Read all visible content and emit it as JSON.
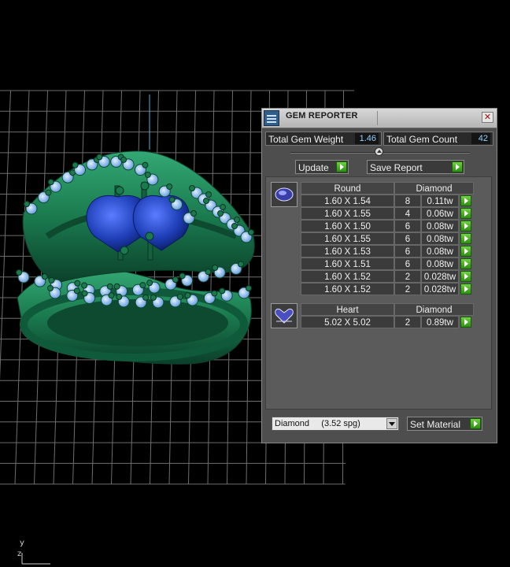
{
  "panel": {
    "title": "GEM REPORTER",
    "close_symbol": "✕",
    "total_gem_weight_label": "Total Gem Weight",
    "total_gem_weight_value": "1.46",
    "total_gem_count_label": "Total Gem Count",
    "total_gem_count_value": "42",
    "update_label": "Update",
    "save_report_label": "Save Report"
  },
  "gem_groups": [
    {
      "shape": "Round",
      "material": "Diamond",
      "icon": "round-gem-icon",
      "rows": [
        {
          "size": "1.60 X 1.54",
          "count": "8",
          "weight": "0.11tw"
        },
        {
          "size": "1.60 X 1.55",
          "count": "4",
          "weight": "0.06tw"
        },
        {
          "size": "1.60 X 1.50",
          "count": "6",
          "weight": "0.08tw"
        },
        {
          "size": "1.60 X 1.55",
          "count": "6",
          "weight": "0.08tw"
        },
        {
          "size": "1.60 X 1.53",
          "count": "6",
          "weight": "0.08tw"
        },
        {
          "size": "1.60 X 1.51",
          "count": "6",
          "weight": "0.08tw"
        },
        {
          "size": "1.60 X 1.52",
          "count": "2",
          "weight": "0.028tw"
        },
        {
          "size": "1.60 X 1.52",
          "count": "2",
          "weight": "0.028tw"
        }
      ]
    },
    {
      "shape": "Heart",
      "material": "Diamond",
      "icon": "heart-gem-icon",
      "rows": [
        {
          "size": "5.02 X 5.02",
          "count": "2",
          "weight": "0.89tw"
        }
      ]
    }
  ],
  "material": {
    "selected": "Diamond     (3.52 spg)",
    "set_material_label": "Set Material"
  },
  "viewport": {
    "axis_y": "y",
    "axis_z": "z",
    "colors": {
      "ring": "#1f8a5a",
      "ring_dark": "#0d4a30",
      "stone_accent": "#9ac8ff",
      "heart_stone": "#1f3fb8",
      "grid": "#6e6e6e"
    }
  }
}
